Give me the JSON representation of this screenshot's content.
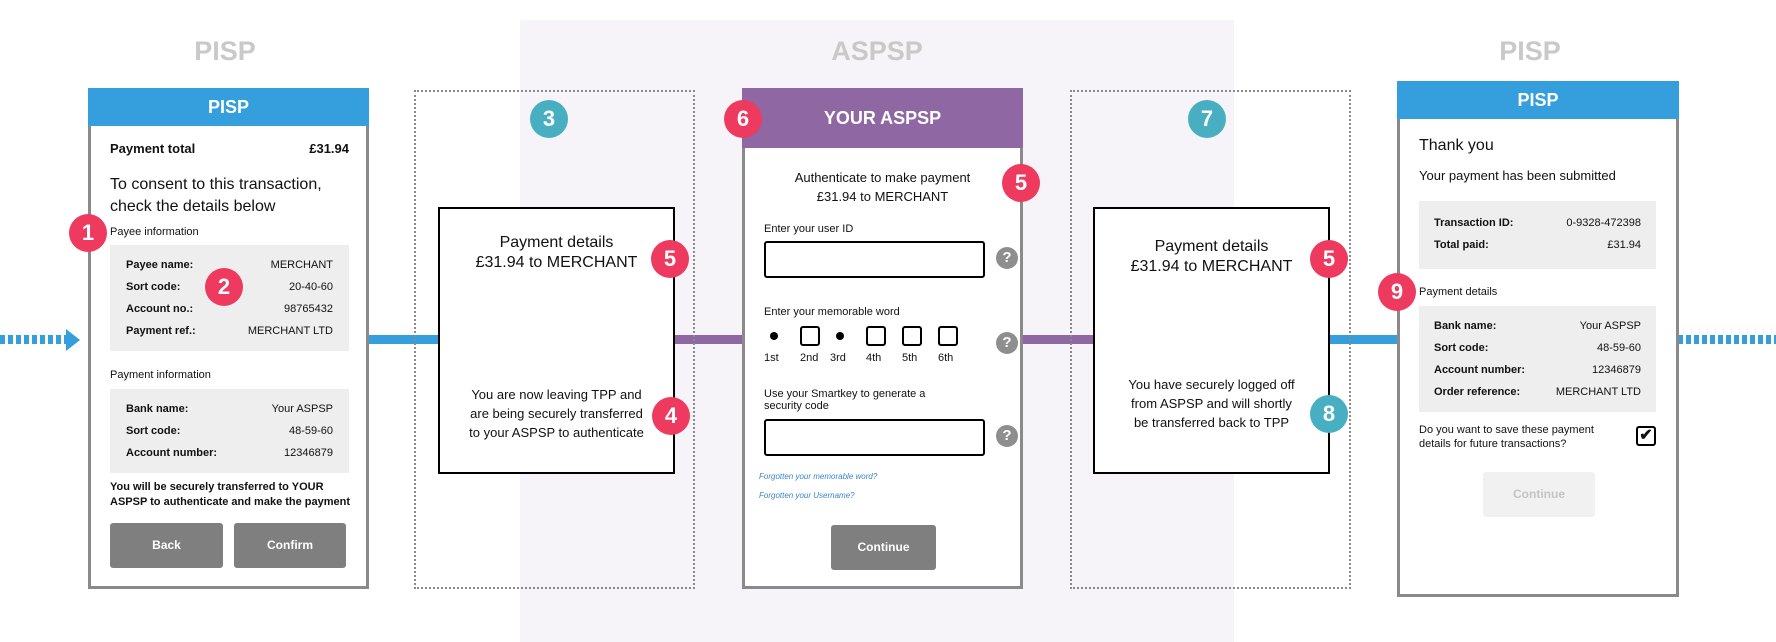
{
  "zones": {
    "left_title": "PISP",
    "middle_title": "ASPSP",
    "right_title": "PISP"
  },
  "colors": {
    "pisp_blue": "#359edd",
    "aspsp_purple": "#8e67a3",
    "badge_red": "#ee3a5f",
    "badge_teal": "#48afc2"
  },
  "screen1": {
    "header": "PISP",
    "payment_total_label": "Payment total",
    "payment_total_value": "£31.94",
    "consent_text_line1": "To consent to this transaction,",
    "consent_text_line2": "check the details below",
    "payee_section_label": "Payee information",
    "payee_rows": [
      {
        "label": "Payee name:",
        "value": "MERCHANT"
      },
      {
        "label": "Sort code:",
        "value": "20-40-60"
      },
      {
        "label": "Account no.:",
        "value": "98765432"
      },
      {
        "label": "Payment ref.:",
        "value": "MERCHANT LTD"
      }
    ],
    "payment_section_label": "Payment information",
    "payment_rows": [
      {
        "label": "Bank name:",
        "value": "Your ASPSP"
      },
      {
        "label": "Sort code:",
        "value": "48-59-60"
      },
      {
        "label": "Account number:",
        "value": "12346879"
      }
    ],
    "transfer_note_line1": "You will be securely transferred to YOUR",
    "transfer_note_line2": "ASPSP to authenticate and make the payment",
    "back_button": "Back",
    "confirm_button": "Confirm"
  },
  "step3": {
    "payment_details_line1": "Payment details",
    "payment_details_line2": "£31.94 to MERCHANT",
    "message_line1": "You are now leaving TPP and",
    "message_line2": "are being securely transferred",
    "message_line3": "to your ASPSP to authenticate"
  },
  "aspsp": {
    "header": "YOUR ASPSP",
    "auth_line1": "Authenticate to make payment",
    "auth_line2": "£31.94 to MERCHANT",
    "user_id_label": "Enter your user ID",
    "user_id_value": "",
    "memorable_label": "Enter your memorable word",
    "memorable_positions": [
      {
        "label": "1st",
        "type": "dot"
      },
      {
        "label": "2nd",
        "type": "box"
      },
      {
        "label": "3rd",
        "type": "dot"
      },
      {
        "label": "4th",
        "type": "box"
      },
      {
        "label": "5th",
        "type": "box"
      },
      {
        "label": "6th",
        "type": "box"
      }
    ],
    "smartkey_label_line1": "Use your Smartkey to generate a",
    "smartkey_label_line2": "security code",
    "smartkey_value": "",
    "help_glyph": "?",
    "forgot_memorable": "Forgotten your memorable word?",
    "forgot_username": "Forgotten your Username?",
    "continue_button": "Continue"
  },
  "step7": {
    "payment_details_line1": "Payment details",
    "payment_details_line2": "£31.94 to MERCHANT",
    "message_line1": "You have securely logged off",
    "message_line2": "from ASPSP and will shortly",
    "message_line3": "be transferred back to TPP"
  },
  "screen_final": {
    "header": "PISP",
    "thank_you": "Thank you",
    "submitted": "Your payment has been submitted",
    "summary_rows": [
      {
        "label": "Transaction ID:",
        "value": "0-9328-472398"
      },
      {
        "label": "Total paid:",
        "value": "£31.94"
      }
    ],
    "details_label": "Payment details",
    "detail_rows": [
      {
        "label": "Bank name:",
        "value": "Your ASPSP"
      },
      {
        "label": "Sort code:",
        "value": "48-59-60"
      },
      {
        "label": "Account number:",
        "value": "12346879"
      },
      {
        "label": "Order reference:",
        "value": "MERCHANT LTD"
      }
    ],
    "save_question_line1": "Do you want to save these payment",
    "save_question_line2": "details for future transactions?",
    "save_checked": true,
    "check_glyph": "✔",
    "continue_button": "Continue"
  },
  "badges": {
    "b1": "1",
    "b2": "2",
    "b3": "3",
    "b4": "4",
    "b5": "5",
    "b6": "6",
    "b7": "7",
    "b8": "8",
    "b9": "9"
  }
}
